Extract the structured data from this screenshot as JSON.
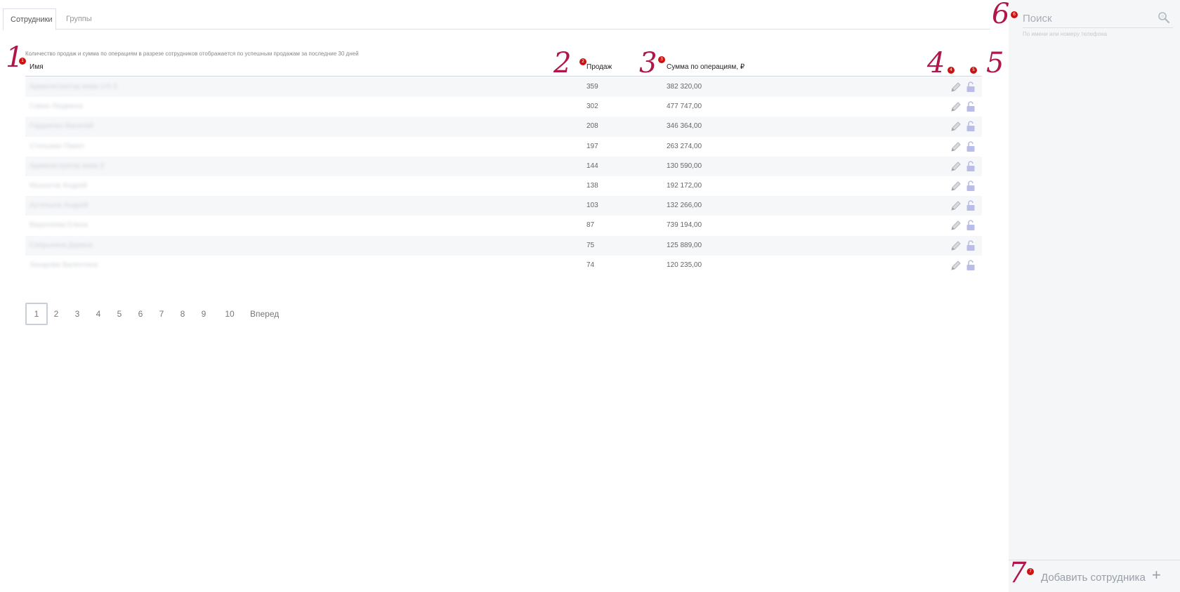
{
  "tabs": [
    {
      "label": "Сотрудники",
      "active": true
    },
    {
      "label": "Группы",
      "active": false
    }
  ],
  "info_text": "Количество продаж и сумма по операциям в разрезе сотрудников отображается по успешным продажам за последние 30 дней",
  "table": {
    "columns": [
      "Имя",
      "Продаж",
      "Сумма по операциям, ₽"
    ],
    "rows": [
      {
        "name": "Администратор жива стб 3",
        "sales": "359",
        "sum": "382 320,00"
      },
      {
        "name": "Савин Людмила",
        "sales": "302",
        "sum": "477 747,00"
      },
      {
        "name": "Гордиенко Василий",
        "sales": "208",
        "sum": "346 364,00"
      },
      {
        "name": "Стельман Павел",
        "sales": "197",
        "sum": "263 274,00"
      },
      {
        "name": "Администратор жива 8",
        "sales": "144",
        "sum": "130 590,00"
      },
      {
        "name": "Мышатов Андрей",
        "sales": "138",
        "sum": "192 172,00"
      },
      {
        "name": "Аутеншев Андрей",
        "sales": "103",
        "sum": "132 266,00"
      },
      {
        "name": "Видолеева Елена",
        "sales": "87",
        "sum": "739 194,00"
      },
      {
        "name": "Сапрыкина Дарина",
        "sales": "75",
        "sum": "125 889,00"
      },
      {
        "name": "Захарова Валентина",
        "sales": "74",
        "sum": "120 235,00"
      }
    ]
  },
  "pagination": {
    "pages": [
      "1",
      "2",
      "3",
      "4",
      "5",
      "6",
      "7",
      "8",
      "9",
      "10"
    ],
    "current": "1",
    "next_label": "Вперед"
  },
  "sidebar": {
    "search_placeholder": "Поиск",
    "search_hint": "По имени или номеру телефона",
    "add_label": "Добавить сотрудника",
    "add_icon": "+"
  },
  "annotations": {
    "numbers": [
      "1",
      "2",
      "3",
      "4",
      "5",
      "6",
      "7"
    ],
    "markers": [
      "1",
      "2",
      "3",
      "4",
      "5",
      "6",
      "7"
    ]
  },
  "colors": {
    "accent_icon": "#b9bde8",
    "annotation": "#b0164a",
    "marker": "#cc1111"
  }
}
